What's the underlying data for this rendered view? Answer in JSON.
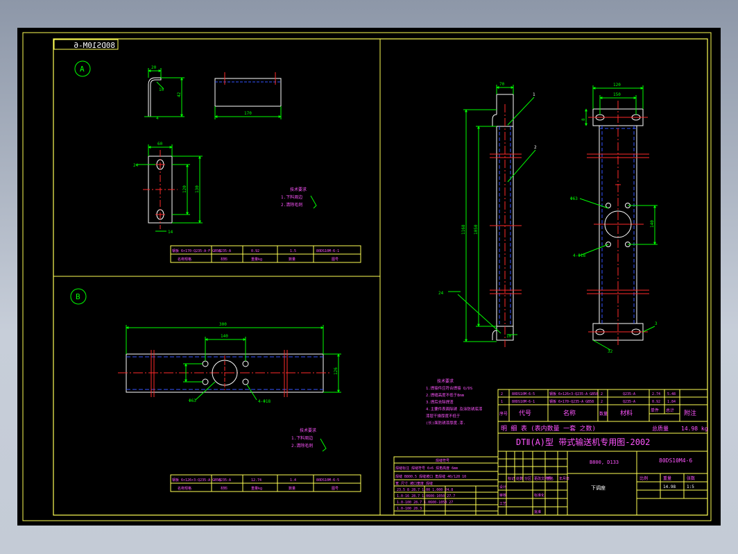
{
  "sheet": {
    "mirrored_title": "80DS10M-6",
    "view_a_label": "A",
    "view_b_label": "B"
  },
  "view_a": {
    "dims": [
      "20",
      "10",
      "42",
      "4",
      "170",
      "60",
      "120",
      "130",
      "14",
      "24"
    ],
    "note_title": "技术要求",
    "notes": [
      "1.下料周边",
      "2.清除毛刺"
    ],
    "table_row1": [
      "钢板 6×170-Q235-A·F GB58",
      "Q235-A",
      "0.92",
      "1.5",
      "80DS10M-6-1"
    ],
    "table_row2": [
      "名称规格",
      "材料",
      "重量kg",
      "数量",
      "图号"
    ]
  },
  "view_b": {
    "dims": [
      "300",
      "140",
      "126",
      "Φ63",
      "4-Φ18"
    ],
    "note_title": "技术要求",
    "notes": [
      "1.下料周边",
      "2.清除毛刺"
    ],
    "table_row1": [
      "钢板 6×126×3-Q235-A GB58",
      "Q235-A",
      "12.74",
      "1.4",
      "80DS10M-6-5"
    ],
    "table_row2": [
      "名称规格",
      "材料",
      "重量kg",
      "数量",
      "图号"
    ]
  },
  "main_view": {
    "dims": [
      "120",
      "150",
      "1168",
      "1050",
      "70",
      "8",
      "32",
      "3",
      "1",
      "2",
      "24",
      "10",
      "Φ63",
      "4-Φ18",
      "140",
      "1"
    ]
  },
  "tech_req": {
    "title": "技术要求",
    "lines": [
      "1.焊接件应符合焊接 Q/DS",
      "2.焊缝高度不低于8mm",
      "3.焊后去除焊渣",
      "4.主要件表面除锈 及涂防锈底漆",
      "漆层干燥厚度不低于",
      "(长)面防锈漆厚度.漆."
    ]
  },
  "bom": {
    "rows": [
      [
        "2",
        "80DS10M-6-5",
        "钢板 6×126×3-Q235-A GB58",
        "2",
        "Q235-A",
        "2.74",
        "5.48"
      ],
      [
        "1",
        "80DS10M-6-1",
        "钢板 6×170-Q235-A GB58",
        "2",
        "Q235-A",
        "0.92",
        "1.84"
      ]
    ],
    "header": [
      "序号",
      "代号",
      "名称",
      "数量",
      "材料",
      "单件",
      "总计",
      "附注"
    ],
    "summary_left": "明 细 表 (表内数量 一套 之数)",
    "total_label": "总质量",
    "total_value": "14.98 kg"
  },
  "title_block": {
    "main_title": "DTⅡ(A)型 带式输送机专用图-2002",
    "spec": "B800, D133",
    "drawing_no": "80DS10M4-6",
    "part_name": "下调座",
    "scale_label": "比例",
    "weight_label": "重量",
    "sheet_label": "张数",
    "weight_value": "14.98",
    "scale_value": "1:5",
    "row_labels": [
      "标记",
      "处数",
      "分区",
      "更改文件号",
      "签名",
      "年月日",
      "设计",
      "审核",
      "工艺",
      "标准化",
      "批准"
    ]
  },
  "change_table": {
    "title": "焊缝符号",
    "lines": [
      "焊缝标注 焊缝符号 6×6 焊角高度 6mm",
      "焊缝 B800.5 焊缝坡口 角焊缝 40/120 10",
      "宽 尺寸 坡口宽度 焊缝",
      "23.5 8  28.7  1.00 1.000  24.8",
      "1.0-16 28.7 1.0600-1050 27.7",
      "1.0-100 28.7 1.0600-1050 27",
      "1.0-100 28.3"
    ]
  },
  "colors": {
    "frame": "#ffff55",
    "geometry": "#ffffff",
    "dimension": "#00ff00",
    "centerline": "#ff2a2a",
    "hidden": "#3355ff",
    "text": "#ff55ff",
    "label": "#00ff00"
  }
}
